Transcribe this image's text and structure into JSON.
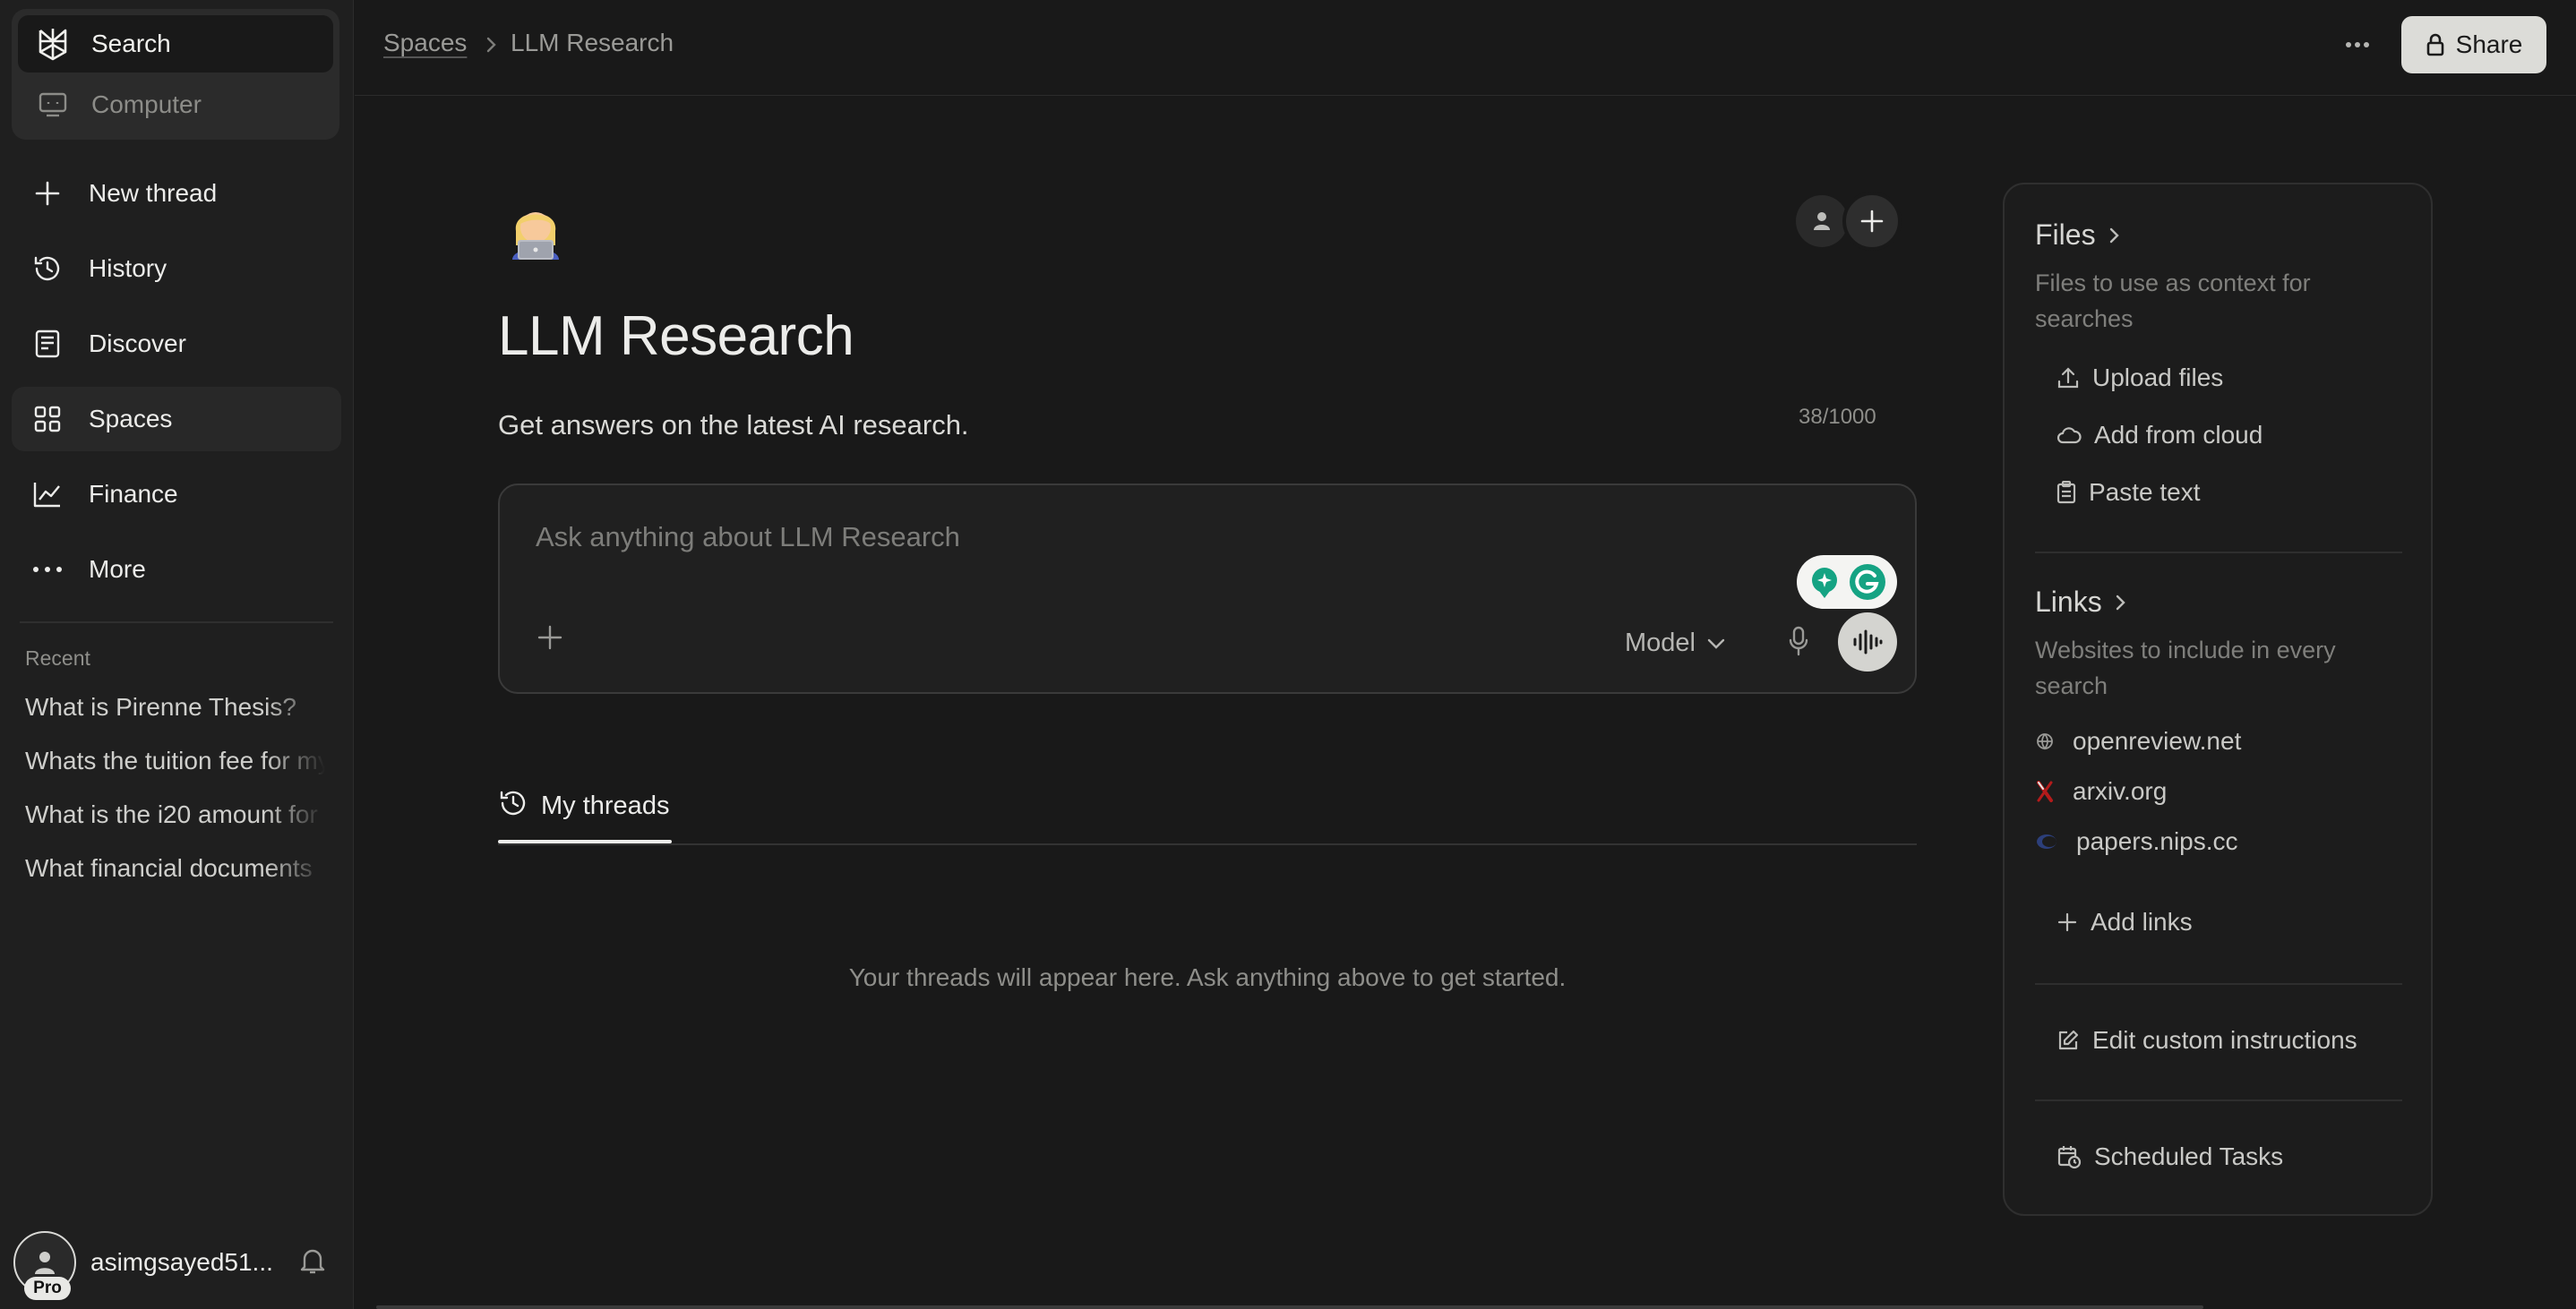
{
  "sidebar": {
    "modes": {
      "search": "Search",
      "computer": "Computer"
    },
    "nav": {
      "new_thread": "New thread",
      "history": "History",
      "discover": "Discover",
      "spaces": "Spaces",
      "finance": "Finance",
      "more": "More"
    },
    "recent_label": "Recent",
    "recent": [
      "What is Pirenne Thesis?",
      "Whats the tuition fee for my",
      "What is the i20 amount for",
      "What financial documents"
    ],
    "user": {
      "name": "asimgsayed51...",
      "badge": "Pro"
    }
  },
  "topbar": {
    "breadcrumb": [
      "Spaces",
      "LLM Research"
    ],
    "share_label": "Share"
  },
  "space": {
    "emoji": "technologist-emoji",
    "title": "LLM Research",
    "description": "Get answers on the latest AI research.",
    "char_count": "38/1000"
  },
  "ask": {
    "placeholder": "Ask anything about LLM Research",
    "model_label": "Model"
  },
  "threads": {
    "tab_label": "My threads",
    "empty_message": "Your threads will appear here. Ask anything above to get started."
  },
  "panel": {
    "files": {
      "title": "Files",
      "subtitle": "Files to use as context for searches",
      "actions": [
        "Upload files",
        "Add from cloud",
        "Paste text"
      ]
    },
    "links": {
      "title": "Links",
      "subtitle": "Websites to include in every search",
      "items": [
        "openreview.net",
        "arxiv.org",
        "papers.nips.cc"
      ],
      "add_label": "Add links"
    },
    "edit_instructions": "Edit custom instructions",
    "scheduled_tasks": "Scheduled Tasks"
  },
  "colors": {
    "background": "#191919",
    "sidebar": "#1f1f1f",
    "share_button": "#dcdcd8",
    "grammarly_green": "#15a383",
    "arxiv_red": "#b31b1b"
  }
}
